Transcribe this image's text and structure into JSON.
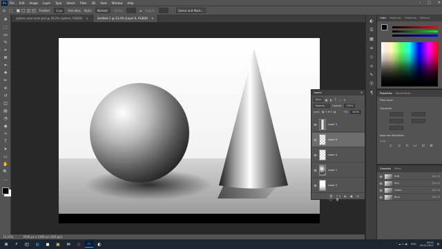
{
  "app": {
    "logo": "Ps"
  },
  "menu": [
    "File",
    "Edit",
    "Image",
    "Layer",
    "Type",
    "Select",
    "Filter",
    "3D",
    "View",
    "Window",
    "Help"
  ],
  "window_controls": [
    "–",
    "□",
    "✕"
  ],
  "options": {
    "feather_label": "Feather:",
    "feather_value": "0 px",
    "antialias": "Anti-alias",
    "style_label": "Style:",
    "style_value": "Normal",
    "width_label": "Width:",
    "height_label": "Height:",
    "select_mask": "Select and Mask..."
  },
  "tabs": [
    {
      "label": "sphere cone cone.psd @ 26,2% (sphere, RGB/8)",
      "active": false
    },
    {
      "label": "Untitled-1 @ 33,4% (Layer 6, RGB/8)",
      "active": true
    }
  ],
  "tools": [
    "move-tool",
    "marquee-tool",
    "lasso-tool",
    "quick-select-tool",
    "crop-tool",
    "frame-tool",
    "eyedropper-tool",
    "healing-tool",
    "brush-tool",
    "stamp-tool",
    "history-brush-tool",
    "eraser-tool",
    "gradient-tool",
    "blur-tool",
    "dodge-tool",
    "pen-tool",
    "type-tool",
    "path-select-tool",
    "rectangle-tool",
    "hand-tool",
    "zoom-tool",
    "more-tools"
  ],
  "tool_glyphs": [
    "✥",
    "⬚",
    "ᔕ",
    "✎",
    "⌗",
    "⊠",
    "✒",
    "✚",
    "✏",
    "⎈",
    "↺",
    "◫",
    "▤",
    "◔",
    "◉",
    "✑",
    "T",
    "➤",
    "▭",
    "✋",
    "🔍",
    "…"
  ],
  "right_strip_glyphs": [
    "◐",
    "☰",
    "▦",
    "≡",
    "◇",
    "⌂",
    "✎",
    "Ⓐ",
    "¶"
  ],
  "color_panel": {
    "tabs": [
      "Color",
      "Swatches",
      "Gradients",
      "Patterns"
    ],
    "foreground": "#000000",
    "background": "#ffffff"
  },
  "properties": {
    "tabs": [
      "Properties",
      "Adjustments"
    ],
    "kind": "Pixel Layer",
    "transform": "Transform",
    "align": "Align and Distribute",
    "align_sub": "Align"
  },
  "channels": {
    "tabs": [
      "Channels",
      "Paths"
    ],
    "rows": [
      {
        "name": "RGB",
        "shortcut": "Ctrl+2"
      },
      {
        "name": "Red",
        "shortcut": "Ctrl+3"
      },
      {
        "name": "Green",
        "shortcut": "Ctrl+4"
      },
      {
        "name": "Blue",
        "shortcut": "Ctrl+5"
      }
    ]
  },
  "layers": {
    "title": "Layers",
    "kind": "Kind",
    "blend": "Normal",
    "opacity_label": "Opacity:",
    "opacity": "100%",
    "lock_label": "Lock:",
    "fill_label": "Fill:",
    "fill": "100%",
    "rows": [
      {
        "name": "Layer 3"
      },
      {
        "name": "Layer 6"
      },
      {
        "name": "Layer 4"
      },
      {
        "name": "Layer 1"
      },
      {
        "name": "Layer 2"
      }
    ]
  },
  "status": {
    "zoom": "33,43%",
    "doc": "3508 px x 2480 px (300 ppi)"
  },
  "taskbar": {
    "apps": [
      "⊞",
      "⌕",
      "◰",
      "◍",
      "◼",
      "▣",
      "✉",
      "◎",
      "Ps",
      "◐"
    ]
  },
  "tray": {
    "lang": "ENG",
    "time": "09:05",
    "date": "16.02.2021"
  }
}
